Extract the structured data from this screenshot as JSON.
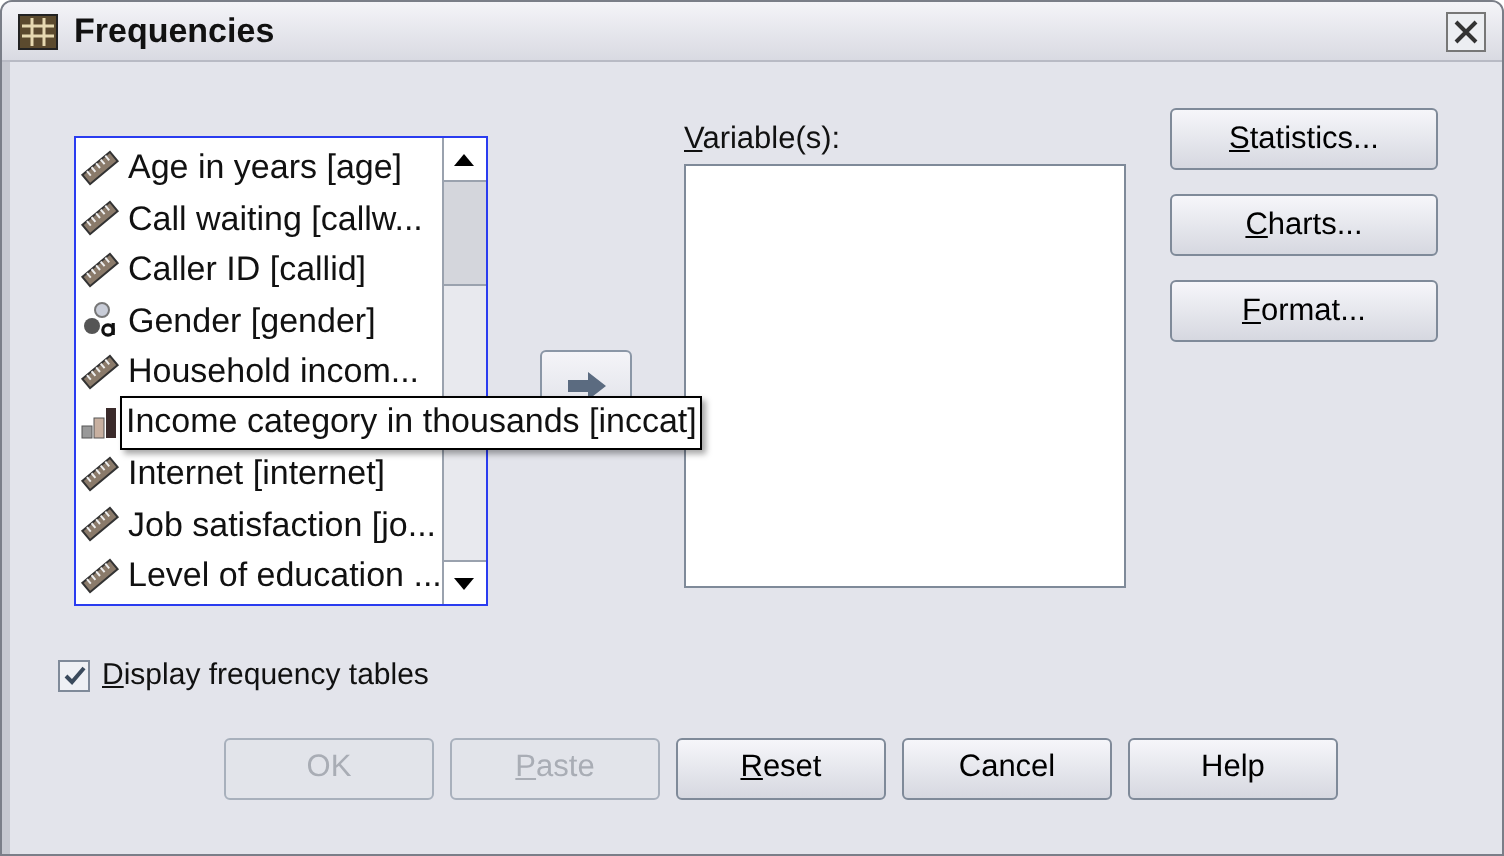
{
  "window": {
    "title": "Frequencies"
  },
  "source_list": {
    "items": [
      {
        "label": "Age in years [age]",
        "kind": "scale",
        "tooltip": false
      },
      {
        "label": "Call waiting [callw...",
        "kind": "scale",
        "tooltip": false
      },
      {
        "label": "Caller ID [callid]",
        "kind": "scale",
        "tooltip": false
      },
      {
        "label": "Gender [gender]",
        "kind": "nominal",
        "tooltip": false
      },
      {
        "label": "Household incom...",
        "kind": "scale",
        "tooltip": false
      },
      {
        "label": "Income category in thousands [inccat]",
        "kind": "ordinal",
        "tooltip": true
      },
      {
        "label": "Internet [internet]",
        "kind": "scale",
        "tooltip": false
      },
      {
        "label": "Job satisfaction [jo...",
        "kind": "scale",
        "tooltip": false
      },
      {
        "label": "Level of education ...",
        "kind": "scale",
        "tooltip": false
      }
    ]
  },
  "variables": {
    "label": "Variable(s):",
    "mnemonic_first": true
  },
  "side_buttons": [
    {
      "label": "Statistics...",
      "mnemonic_first": true
    },
    {
      "label": "Charts...",
      "mnemonic_first": true
    },
    {
      "label": "Format...",
      "mnemonic_first": true
    }
  ],
  "display_tables": {
    "label": "Display frequency tables",
    "checked": true,
    "mnemonic_first": true
  },
  "buttons": [
    {
      "label": "OK",
      "disabled": true,
      "mnemonic_first": false
    },
    {
      "label": "Paste",
      "disabled": true,
      "mnemonic_first": true
    },
    {
      "label": "Reset",
      "disabled": false,
      "mnemonic_first": true
    },
    {
      "label": "Cancel",
      "disabled": false,
      "mnemonic_first": false
    },
    {
      "label": "Help",
      "disabled": false,
      "mnemonic_first": false
    }
  ]
}
